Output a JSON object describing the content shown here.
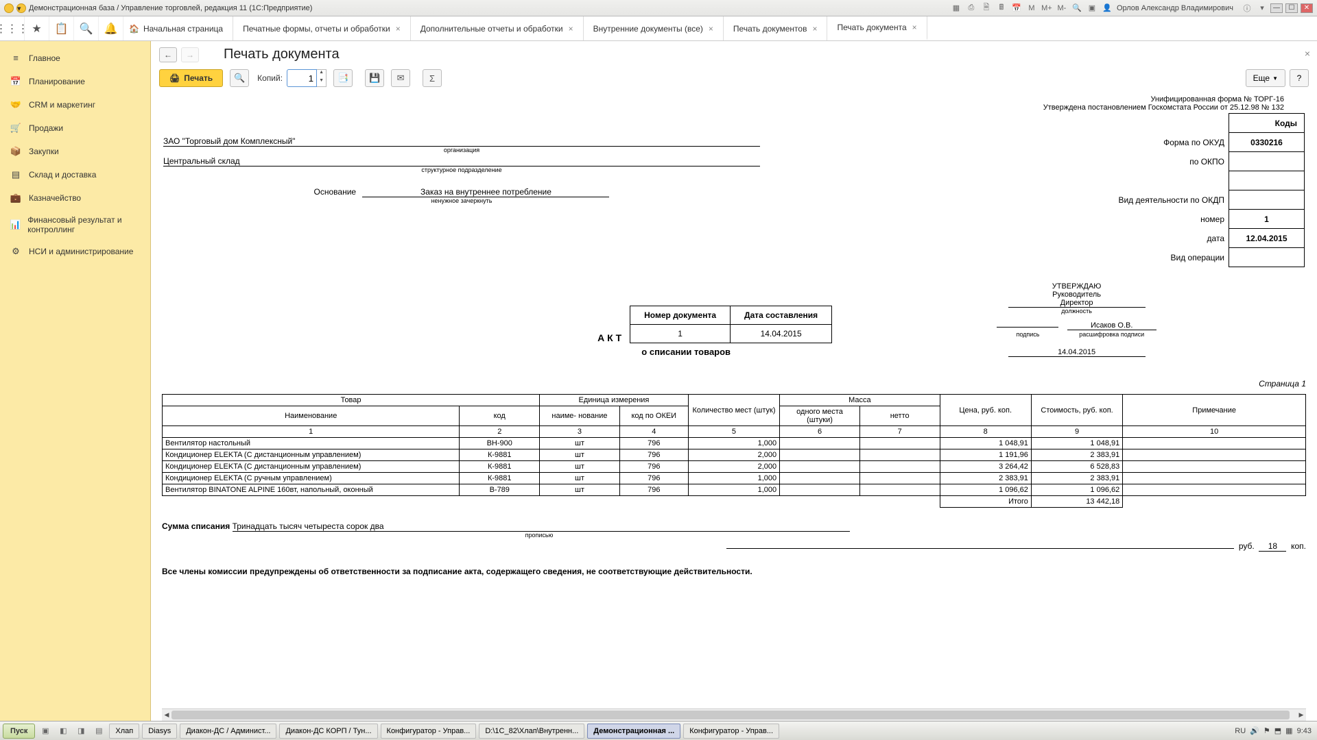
{
  "window_title": "Демонстрационная база / Управление торговлей, редакция 11  (1С:Предприятие)",
  "user": "Орлов Александр Владимирович",
  "tabs": [
    {
      "label": "Начальная страница"
    },
    {
      "label": "Печатные формы, отчеты и обработки"
    },
    {
      "label": "Дополнительные отчеты и обработки"
    },
    {
      "label": "Внутренние документы (все)"
    },
    {
      "label": "Печать документов"
    },
    {
      "label": "Печать документа"
    }
  ],
  "sidebar": {
    "items": [
      {
        "label": "Главное"
      },
      {
        "label": "Планирование"
      },
      {
        "label": "CRM и маркетинг"
      },
      {
        "label": "Продажи"
      },
      {
        "label": "Закупки"
      },
      {
        "label": "Склад и доставка"
      },
      {
        "label": "Казначейство"
      },
      {
        "label": "Финансовый результат и контроллинг"
      },
      {
        "label": "НСИ и администрирование"
      }
    ]
  },
  "page": {
    "title": "Печать документа"
  },
  "toolbar": {
    "print": "Печать",
    "copies_label": "Копий:",
    "copies_value": "1",
    "more": "Еще",
    "help": "?"
  },
  "doc": {
    "form_line1": "Унифицированная форма № ТОРГ-16",
    "form_line2": "Утверждена постановлением Госкомстата России от 25.12.98 № 132",
    "codes_header": "Коды",
    "okud_label": "Форма по ОКУД",
    "okud_value": "0330216",
    "okpo_label": "по ОКПО",
    "okdp_label": "Вид деятельности по ОКДП",
    "number_label": "номер",
    "number_value": "1",
    "date_label": "дата",
    "date_value": "12.04.2015",
    "operation_label": "Вид операции",
    "organization": "ЗАО \"Торговый дом Комплексный\"",
    "organization_caption": "организация",
    "subdivision": "Центральный склад",
    "subdivision_caption": "структурное подразделение",
    "basis_label": "Основание",
    "basis_value": "Заказ на внутреннее потребление",
    "basis_caption": "ненужное зачеркнуть",
    "approve": "УТВЕРЖДАЮ",
    "head": "Руководитель",
    "director": "Директор",
    "position_caption": "должность",
    "signature_caption": "подпись",
    "decipher_caption": "расшифровка подписи",
    "head_name": "Исаков О.В.",
    "approve_date": "14.04.2015",
    "akt_number_header": "Номер документа",
    "akt_date_header": "Дата составления",
    "akt_number": "1",
    "akt_date": "14.04.2015",
    "akt_title": "А К Т",
    "akt_subtitle": "о списании товаров",
    "page_marker": "Страница 1",
    "headers": {
      "goods": "Товар",
      "unit": "Единица измерения",
      "name": "Наименование",
      "code": "код",
      "unit_name": "наиме-\nнование",
      "okei": "код по ОКЕИ",
      "qty_places": "Количество мест (штук)",
      "mass": "Масса",
      "mass_one": "одного места (штуки)",
      "mass_net": "нетто",
      "price": "Цена, руб. коп.",
      "cost": "Стоимость, руб. коп.",
      "note": "Примечание"
    },
    "col_nums": [
      "1",
      "2",
      "3",
      "4",
      "5",
      "6",
      "7",
      "8",
      "9",
      "10"
    ],
    "rows": [
      {
        "name": "Вентилятор настольный",
        "code": "ВН-900",
        "unit": "шт",
        "okei": "796",
        "qty": "1,000",
        "one": "",
        "net": "",
        "price": "1 048,91",
        "cost": "1 048,91",
        "note": ""
      },
      {
        "name": "Кондиционер ELEKTA (С дистанционным управлением)",
        "code": "К-9881",
        "unit": "шт",
        "okei": "796",
        "qty": "2,000",
        "one": "",
        "net": "",
        "price": "1 191,96",
        "cost": "2 383,91",
        "note": ""
      },
      {
        "name": "Кондиционер ELEKTA (С дистанционным управлением)",
        "code": "К-9881",
        "unit": "шт",
        "okei": "796",
        "qty": "2,000",
        "one": "",
        "net": "",
        "price": "3 264,42",
        "cost": "6 528,83",
        "note": ""
      },
      {
        "name": "Кондиционер ELEKTA (С ручным управлением)",
        "code": "К-9881",
        "unit": "шт",
        "okei": "796",
        "qty": "1,000",
        "one": "",
        "net": "",
        "price": "2 383,91",
        "cost": "2 383,91",
        "note": ""
      },
      {
        "name": "Вентилятор BINATONE ALPINE 160вт, напольный, оконный",
        "code": "В-789",
        "unit": "шт",
        "okei": "796",
        "qty": "1,000",
        "one": "",
        "net": "",
        "price": "1 096,62",
        "cost": "1 096,62",
        "note": ""
      }
    ],
    "total_label": "Итого",
    "total_value": "13 442,18",
    "sum_label": "Сумма списания",
    "sum_text": "Тринадцать тысяч четыреста сорок два",
    "sum_caption": "прописью",
    "rub_label": "руб.",
    "kop_value": "18",
    "kop_label": "коп.",
    "warning": "Все члены комиссии предупреждены об ответственности за подписание акта, содержащего сведения, не соответствующие действительности."
  },
  "taskbar": {
    "start": "Пуск",
    "items": [
      {
        "label": "Хлап"
      },
      {
        "label": "Diasys"
      },
      {
        "label": "Диакон-ДС / Админист..."
      },
      {
        "label": "Диакон-ДС КОРП / Тун..."
      },
      {
        "label": "Конфигуратор - Управ..."
      },
      {
        "label": "D:\\1C_82\\Хлап\\Внутренн..."
      },
      {
        "label": "Демонстрационная ..."
      },
      {
        "label": "Конфигуратор - Управ..."
      }
    ],
    "lang": "RU",
    "clock": "9:43"
  }
}
